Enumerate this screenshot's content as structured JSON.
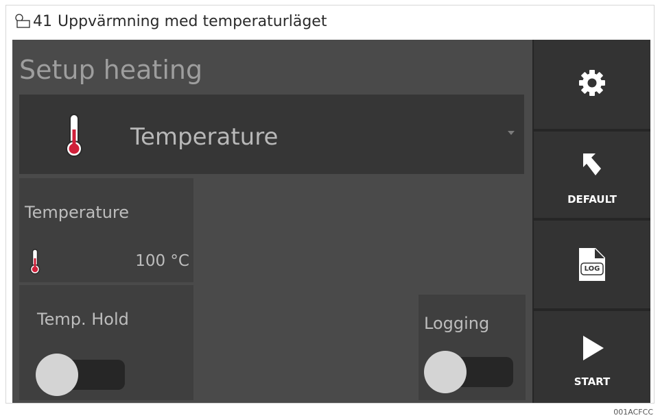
{
  "caption": {
    "number": "41",
    "text": "Uppvärmning med temperaturläget"
  },
  "screen": {
    "title": "Setup heating",
    "mode_dropdown": {
      "selected": "Temperature",
      "icon": "thermometer-icon"
    },
    "temperature_panel": {
      "label": "Temperature",
      "value": "100 °C",
      "icon": "thermometer-icon"
    },
    "temp_hold": {
      "label": "Temp. Hold",
      "state": "off"
    },
    "logging": {
      "label": "Logging",
      "state": "off"
    },
    "sidebar": {
      "settings": {
        "icon": "gear-icon"
      },
      "default": {
        "label": "DEFAULT",
        "icon": "undo-arrow-icon"
      },
      "log": {
        "label": "LOG",
        "icon": "log-file-icon"
      },
      "start": {
        "label": "START",
        "icon": "play-icon"
      }
    }
  },
  "colors": {
    "accent_red": "#d0203a",
    "panel_bg": "#4a4a4a",
    "sidebar_bg": "#333333"
  },
  "image_code": "001ACFCC"
}
